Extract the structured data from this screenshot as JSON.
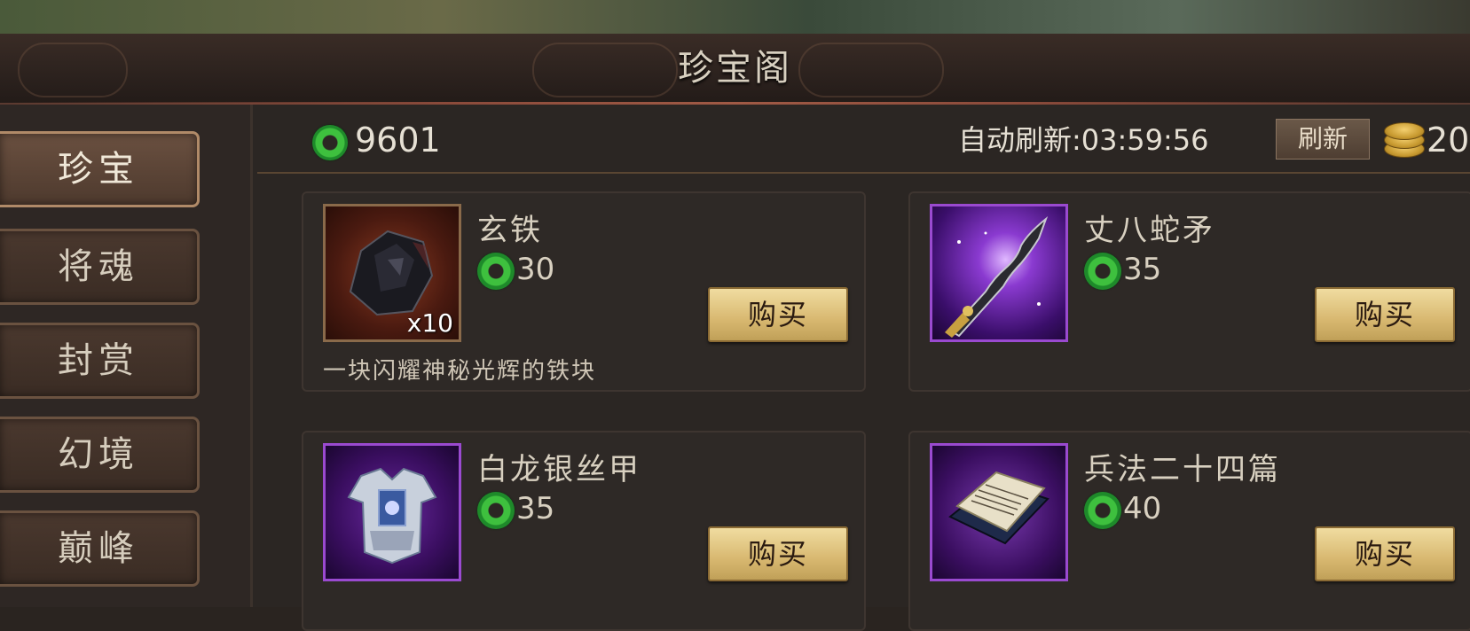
{
  "header": {
    "title": "珍宝阁"
  },
  "sidebar": {
    "tabs": [
      {
        "label": "珍宝",
        "active": true
      },
      {
        "label": "将魂",
        "active": false
      },
      {
        "label": "封赏",
        "active": false
      },
      {
        "label": "幻境",
        "active": false
      },
      {
        "label": "巅峰",
        "active": false
      }
    ]
  },
  "topbar": {
    "jade_balance": "9601",
    "refresh_label": "自动刷新:",
    "refresh_timer": "03:59:56",
    "refresh_button": "刷新",
    "gold_balance": "20"
  },
  "items": [
    {
      "name": "玄铁",
      "price": "30",
      "quantity": "x10",
      "description": "一块闪耀神秘光辉的铁块",
      "buy_label": "购买",
      "frame": "orange",
      "icon": "iron-ore-icon"
    },
    {
      "name": "丈八蛇矛",
      "price": "35",
      "buy_label": "购买",
      "frame": "purple",
      "icon": "serpent-spear-icon"
    },
    {
      "name": "白龙银丝甲",
      "price": "35",
      "buy_label": "购买",
      "frame": "purple",
      "icon": "silver-armor-icon"
    },
    {
      "name": "兵法二十四篇",
      "price": "40",
      "buy_label": "购买",
      "frame": "purple",
      "icon": "book-icon"
    }
  ],
  "colors": {
    "jade": "#3ec03e",
    "gold": "#d8b870",
    "purple_frame": "#9a4ad0"
  }
}
